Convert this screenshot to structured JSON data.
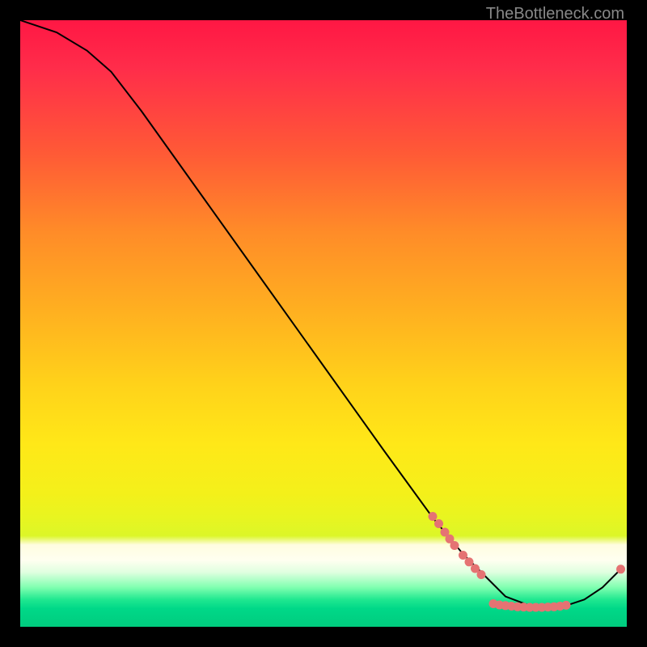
{
  "watermark": "TheBottleneck.com",
  "chart_data": {
    "type": "line",
    "title": "",
    "xlabel": "",
    "ylabel": "",
    "xlim": [
      0,
      100
    ],
    "ylim": [
      0,
      100
    ],
    "grid": false,
    "legend": false,
    "curve": [
      {
        "x": 0,
        "y": 100
      },
      {
        "x": 6,
        "y": 98
      },
      {
        "x": 11,
        "y": 95
      },
      {
        "x": 15,
        "y": 91.5
      },
      {
        "x": 20,
        "y": 85
      },
      {
        "x": 30,
        "y": 71
      },
      {
        "x": 40,
        "y": 57
      },
      {
        "x": 50,
        "y": 43
      },
      {
        "x": 60,
        "y": 29
      },
      {
        "x": 68,
        "y": 18
      },
      {
        "x": 73,
        "y": 12
      },
      {
        "x": 77,
        "y": 8
      },
      {
        "x": 80,
        "y": 5
      },
      {
        "x": 84,
        "y": 3.5
      },
      {
        "x": 87,
        "y": 3.2
      },
      {
        "x": 90,
        "y": 3.5
      },
      {
        "x": 93,
        "y": 4.5
      },
      {
        "x": 96,
        "y": 6.5
      },
      {
        "x": 99,
        "y": 9.5
      }
    ],
    "markers": [
      {
        "x": 68,
        "y": 18.2
      },
      {
        "x": 69,
        "y": 17
      },
      {
        "x": 70,
        "y": 15.6
      },
      {
        "x": 70.8,
        "y": 14.5
      },
      {
        "x": 71.6,
        "y": 13.4
      },
      {
        "x": 73,
        "y": 11.8
      },
      {
        "x": 74,
        "y": 10.7
      },
      {
        "x": 75,
        "y": 9.6
      },
      {
        "x": 76,
        "y": 8.6
      },
      {
        "x": 78,
        "y": 3.8
      },
      {
        "x": 79,
        "y": 3.6
      },
      {
        "x": 80,
        "y": 3.5
      },
      {
        "x": 81,
        "y": 3.4
      },
      {
        "x": 82,
        "y": 3.3
      },
      {
        "x": 83,
        "y": 3.25
      },
      {
        "x": 84,
        "y": 3.2
      },
      {
        "x": 85,
        "y": 3.2
      },
      {
        "x": 86,
        "y": 3.2
      },
      {
        "x": 87,
        "y": 3.25
      },
      {
        "x": 88,
        "y": 3.3
      },
      {
        "x": 89,
        "y": 3.4
      },
      {
        "x": 90,
        "y": 3.55
      },
      {
        "x": 99,
        "y": 9.5
      }
    ],
    "marker_color": "#e57373",
    "line_color": "#000000"
  }
}
